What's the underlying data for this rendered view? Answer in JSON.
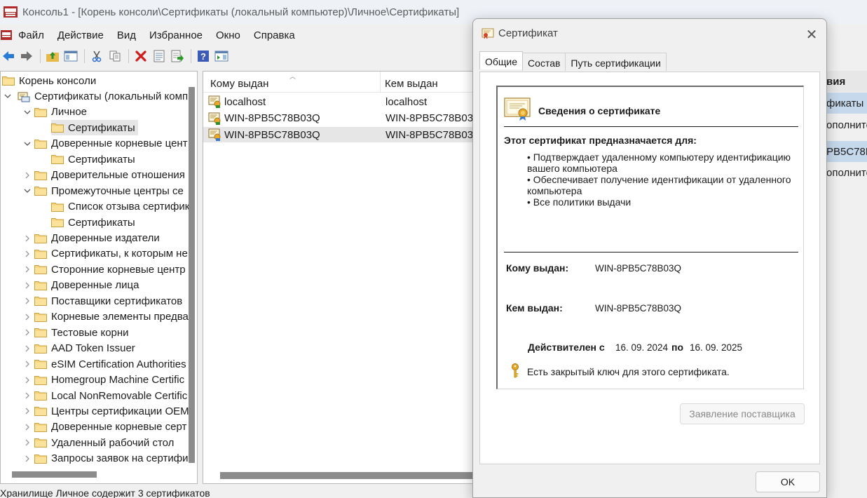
{
  "window": {
    "title": "Консоль1 - [Корень консоли\\Сертификаты (локальный компьютер)\\Личное\\Сертификаты]"
  },
  "menu": [
    "Файл",
    "Действие",
    "Вид",
    "Избранное",
    "Окно",
    "Справка"
  ],
  "toolbar": [
    "back-icon",
    "forward-icon",
    "up-folder-icon",
    "show-hide-tree-icon",
    "cut-icon",
    "copy-icon",
    "delete-icon",
    "properties-icon",
    "export-icon",
    "help-icon",
    "show-action-pane-icon"
  ],
  "tree": [
    {
      "label": "Корень консоли",
      "level": 0,
      "chevron": "none"
    },
    {
      "label": "Сертификаты (локальный комп",
      "level": 0,
      "chevron": "down"
    },
    {
      "label": "Личное",
      "level": 1,
      "chevron": "down"
    },
    {
      "label": "Сертификаты",
      "level": 2,
      "chevron": "none",
      "selected": true
    },
    {
      "label": "Доверенные корневые цент",
      "level": 1,
      "chevron": "down"
    },
    {
      "label": "Сертификаты",
      "level": 2,
      "chevron": "none"
    },
    {
      "label": "Доверительные отношения",
      "level": 1,
      "chevron": "right"
    },
    {
      "label": "Промежуточные центры се",
      "level": 1,
      "chevron": "down"
    },
    {
      "label": "Список отзыва сертифик",
      "level": 2,
      "chevron": "none"
    },
    {
      "label": "Сертификаты",
      "level": 2,
      "chevron": "none"
    },
    {
      "label": "Доверенные издатели",
      "level": 1,
      "chevron": "right"
    },
    {
      "label": "Сертификаты, к которым не",
      "level": 1,
      "chevron": "right"
    },
    {
      "label": "Сторонние корневые центр",
      "level": 1,
      "chevron": "right"
    },
    {
      "label": "Доверенные лица",
      "level": 1,
      "chevron": "right"
    },
    {
      "label": "Поставщики сертификатов",
      "level": 1,
      "chevron": "right"
    },
    {
      "label": "Корневые элементы предва",
      "level": 1,
      "chevron": "right"
    },
    {
      "label": "Тестовые корни",
      "level": 1,
      "chevron": "right"
    },
    {
      "label": "AAD Token Issuer",
      "level": 1,
      "chevron": "right"
    },
    {
      "label": "eSIM Certification Authorities",
      "level": 1,
      "chevron": "right"
    },
    {
      "label": "Homegroup Machine Certific",
      "level": 1,
      "chevron": "right"
    },
    {
      "label": "Local NonRemovable Certific",
      "level": 1,
      "chevron": "right"
    },
    {
      "label": "Центры сертификации OEM",
      "level": 1,
      "chevron": "right"
    },
    {
      "label": "Доверенные корневые серт",
      "level": 1,
      "chevron": "right"
    },
    {
      "label": "Удаленный рабочий стол",
      "level": 1,
      "chevron": "right"
    },
    {
      "label": "Запросы заявок на сертифи",
      "level": 1,
      "chevron": "right"
    }
  ],
  "list": {
    "columns": [
      "Кому выдан",
      "Кем выдан"
    ],
    "rows": [
      {
        "issued_to": "localhost",
        "issued_by": "localhost",
        "selected": false
      },
      {
        "issued_to": "WIN-8PB5C78B03Q",
        "issued_by": "WIN-8PB5C78B03Q",
        "selected": false
      },
      {
        "issued_to": "WIN-8PB5C78B03Q",
        "issued_by": "WIN-8PB5C78B03Q",
        "selected": true
      }
    ]
  },
  "actions": {
    "header": "вия",
    "items": [
      "фикаты",
      "ополните",
      "PB5C78B0",
      "ополните"
    ]
  },
  "status": "Хранилище Личное содержит 3 сертификатов",
  "dialog": {
    "title": "Сертификат",
    "tabs": [
      "Общие",
      "Состав",
      "Путь сертификации"
    ],
    "info_title": "Сведения о сертификате",
    "purpose_heading": "Этот сертификат предназначается для:",
    "bullets": [
      "• Подтверждает удаленному компьютеру идентификацию вашего компьютера",
      "• Обеспечивает получение идентификации от удаленного компьютера",
      "• Все политики выдачи"
    ],
    "issued_to_label": "Кому выдан:",
    "issued_to_value": "WIN-8PB5C78B03Q",
    "issued_by_label": "Кем выдан:",
    "issued_by_value": "WIN-8PB5C78B03Q",
    "valid_from_label": "Действителен с",
    "valid_from": "16. 09. 2024",
    "valid_to_label": "по",
    "valid_to": "16. 09. 2025",
    "private_key_note": "Есть закрытый ключ для этого сертификата.",
    "issuer_statement_button": "Заявление поставщика",
    "ok_button": "OK"
  }
}
